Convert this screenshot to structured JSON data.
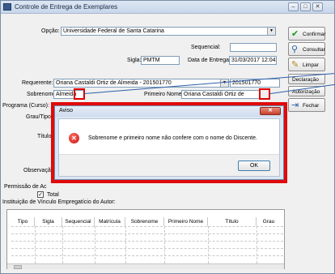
{
  "window": {
    "title": "Controle de Entrega de Exemplares",
    "minimize": "–",
    "maximize": "□",
    "close": "✕"
  },
  "form": {
    "opcao_label": "Opção:",
    "opcao_value": "Universidade Federal de Santa Catarina",
    "sequencial_label": "Sequencial:",
    "sequencial_value": "",
    "sigla_label": "Sigla:",
    "sigla_value": "PMTM",
    "data_entrega_label": "Data de Entrega:",
    "data_entrega_value": "31/03/2017 12:04",
    "requerente_label": "Requerente:",
    "requerente_value": "Oriana Castaldi Ortiz de Almeida - 201501770",
    "requerente_code": "201501770",
    "sobrenome_label": "Sobrenome:",
    "sobrenome_value": "Almeida",
    "primeiro_nome_label": "Primeiro Nome:",
    "primeiro_nome_value": "Oriana Castaldi Ortiz de",
    "programa_label": "Programa (Curso):",
    "grau_tipo_label": "Grau/Tipo:",
    "titulo_label": "Título:",
    "observacao_label": "Observação:",
    "permissao_label": "Permissão de Ac",
    "total_label": "Total",
    "instituicao_label": "Instituição de Vínculo Empregatício do Autor:"
  },
  "buttons": {
    "confirmar": "Confirmar",
    "consultar": "Consultar",
    "limpar": "Limpar",
    "declaracao": "Declaração",
    "autorizacao": "Autorização",
    "fechar": "Fechar"
  },
  "icons": {
    "confirmar": "checkmark-icon",
    "consultar": "search-icon",
    "limpar": "broom-icon",
    "fechar": "exit-icon",
    "error": "error-icon"
  },
  "dialog": {
    "title": "Aviso",
    "close": "✕",
    "message": "Sobrenome e primeiro nome não confere com o nome do Discente.",
    "ok_label": "OK",
    "error_glyph": "✕"
  },
  "grid": {
    "columns": [
      "Tipo",
      "Sigla",
      "Sequencial",
      "Matrícula",
      "Sobrenome",
      "Primeiro Nome",
      "Título",
      "Grau"
    ]
  },
  "colors": {
    "highlight": "#e00a0a",
    "annotation": "#2d5fa8"
  }
}
